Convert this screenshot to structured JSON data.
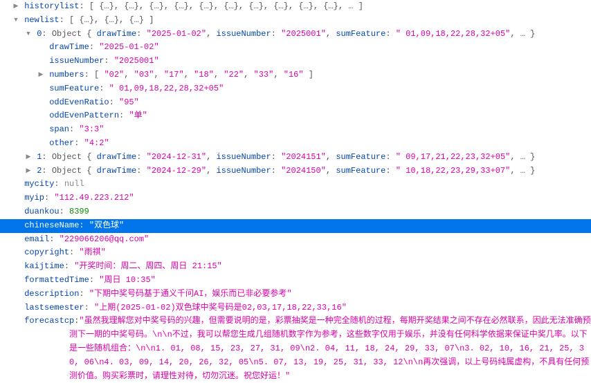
{
  "root": {
    "historylist": {
      "summary": "[ {…}, {…}, {…}, {…}, {…}, {…}, {…}, {…}, {…}, {…}, … ]"
    },
    "newlist": {
      "summary": "[ {…}, {…}, {…} ]",
      "items": [
        {
          "index": "0",
          "summary": "Object { drawTime: \"2025-01-02\", issueNumber: \"2025001\", sumFeature: \" 01,09,18,22,28,32+05\", … }",
          "drawTime": "2025-01-02",
          "issueNumber": "2025001",
          "numbers_summary": "[ \"02\", \"03\", \"17\", \"18\", \"22\", \"33\", \"16\" ]",
          "sumFeature": " 01,09,18,22,28,32+05",
          "oddEvenRatio": "95",
          "oddEvenPattern": "单",
          "span": "3:3",
          "other": "4:2"
        },
        {
          "index": "1",
          "summary": "Object { drawTime: \"2024-12-31\", issueNumber: \"2024151\", sumFeature: \" 09,17,21,22,23,32+05\", … }"
        },
        {
          "index": "2",
          "summary": "Object { drawTime: \"2024-12-29\", issueNumber: \"2024150\", sumFeature: \" 10,18,22,23,29,33+07\", … }"
        }
      ]
    },
    "mycity": "null",
    "myip": "112.49.223.212",
    "duankou": "8399",
    "chineseName": "双色球",
    "email": "229066206@qq.com",
    "copyright": "雨祺",
    "kaijtime": "开奖时间：周二、周四、周日 21:15",
    "formattedTime": "周日 10:35",
    "description": "下期中奖号码基于通义千问AI，娱乐而已非必要参考",
    "lastsemester": "上期(2025-01-02)双色球中奖号码是02,03,17,18,22,33,16",
    "forecastcp": "虽然我理解您对中奖号码的兴趣，但需要说明的是，彩票抽奖是一种完全随机的过程，每期开奖结果之间不存在必然联系，因此无法准确预测下一期的中奖号码。\\n\\n不过，我可以帮您生成几组随机数字作为参考，这些数字仅用于娱乐，并没有任何科学依据来保证中奖几率。以下是一些随机组合：\\n\\n1. 01, 08, 15, 23, 27, 31, 09\\n2. 04, 11, 18, 24, 29, 33, 07\\n3. 02, 10, 16, 21, 25, 30, 06\\n4. 03, 09, 14, 20, 26, 32, 05\\n5. 07, 13, 19, 25, 31, 33, 12\\n\\n再次强调，以上号码纯属虚构，不具有任何预测价值。购买彩票时，请理性对待，切勿沉迷。祝您好运！"
  },
  "labels": {
    "historylist": "historylist",
    "newlist": "newlist",
    "drawTime": "drawTime",
    "issueNumber": "issueNumber",
    "numbers": "numbers",
    "sumFeature": "sumFeature",
    "oddEvenRatio": "oddEvenRatio",
    "oddEvenPattern": "oddEvenPattern",
    "span": "span",
    "other": "other",
    "mycity": "mycity",
    "myip": "myip",
    "duankou": "duankou",
    "chineseName": "chineseName",
    "email": "email",
    "copyright": "copyright",
    "kaijtime": "kaijtime",
    "formattedTime": "formattedTime",
    "description": "description",
    "lastsemester": "lastsemester",
    "forecastcp": "forecastcp"
  }
}
